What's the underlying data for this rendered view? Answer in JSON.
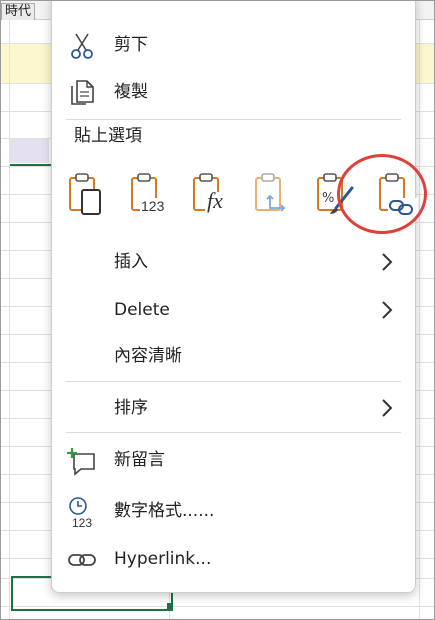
{
  "sheet": {
    "tab_label": "時代"
  },
  "menu": {
    "cut_label": "剪下",
    "copy_label": "複製",
    "paste_options_title": "貼上選項",
    "paste_options": [
      {
        "name": "paste-default",
        "icon": "clipboard-page-icon"
      },
      {
        "name": "paste-values",
        "icon": "clipboard-123-icon",
        "glyph": "123"
      },
      {
        "name": "paste-formulas",
        "icon": "clipboard-fx-icon",
        "glyph": "fx"
      },
      {
        "name": "paste-transpose",
        "icon": "clipboard-transpose-icon"
      },
      {
        "name": "paste-formatting",
        "icon": "clipboard-brush-icon"
      },
      {
        "name": "paste-link",
        "icon": "clipboard-link-icon"
      }
    ],
    "insert_label": "插入",
    "delete_label": "Delete",
    "clear_contents_label": "內容清晰",
    "sort_label": "排序",
    "new_comment_label": "新留言",
    "number_format_label": "數字格式......",
    "hyperlink_label": "Hyperlink..."
  },
  "colors": {
    "accent_orange": "#d47a1f",
    "icon_blue": "#2b5797",
    "highlight_red": "#e0403a",
    "comment_green": "#2e9b4b"
  }
}
